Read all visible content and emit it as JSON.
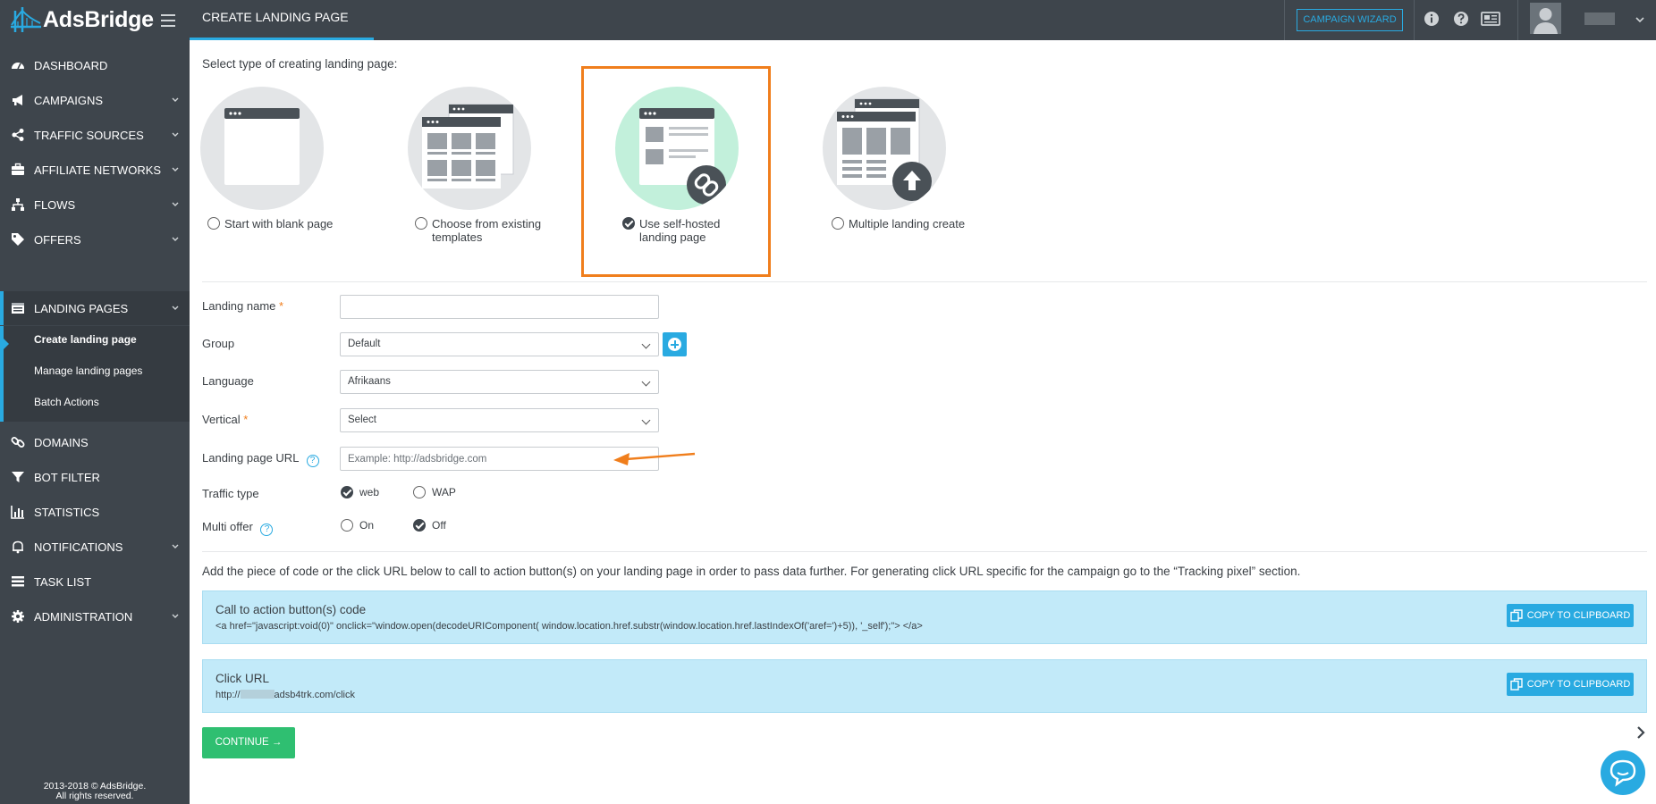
{
  "header": {
    "brand": "AdsBridge",
    "page_title": "CREATE LANDING PAGE",
    "campaign_wizard_label": "CAMPAIGN WIZARD"
  },
  "sidebar": {
    "items": [
      {
        "label": "DASHBOARD",
        "icon": "dashboard-icon"
      },
      {
        "label": "CAMPAIGNS",
        "icon": "megaphone-icon"
      },
      {
        "label": "TRAFFIC SOURCES",
        "icon": "share-icon"
      },
      {
        "label": "AFFILIATE NETWORKS",
        "icon": "briefcase-icon"
      },
      {
        "label": "FLOWS",
        "icon": "sitemap-icon"
      },
      {
        "label": "OFFERS",
        "icon": "tags-icon"
      },
      {
        "label": "LANDING PAGES",
        "icon": "landing-pages-icon"
      },
      {
        "label": "DOMAINS",
        "icon": "link-icon"
      },
      {
        "label": "BOT FILTER",
        "icon": "filter-icon"
      },
      {
        "label": "STATISTICS",
        "icon": "bar-chart-icon"
      },
      {
        "label": "NOTIFICATIONS",
        "icon": "bell-icon"
      },
      {
        "label": "TASK LIST",
        "icon": "list-icon"
      },
      {
        "label": "ADMINISTRATION",
        "icon": "gear-icon"
      }
    ],
    "sub_items": [
      "Create landing page",
      "Manage landing pages",
      "Batch Actions"
    ],
    "copyright_line1": "2013-2018 © AdsBridge.",
    "copyright_line2": "All rights reserved."
  },
  "main": {
    "select_type_title": "Select type of creating landing page:",
    "types": [
      {
        "label": "Start with blank page",
        "selected": false
      },
      {
        "label_line1": "Choose from existing",
        "label_line2": "templates",
        "selected": false
      },
      {
        "label_line1": "Use self-hosted",
        "label_line2": "landing page",
        "selected": true
      },
      {
        "label": "Multiple landing create",
        "selected": false
      }
    ],
    "form": {
      "landing_name_label": "Landing name",
      "landing_name_value": "",
      "group_label": "Group",
      "group_value": "Default",
      "language_label": "Language",
      "language_value": "Afrikaans",
      "vertical_label": "Vertical",
      "vertical_value": "Select",
      "url_label": "Landing page URL",
      "url_placeholder": "Example: http://adsbridge.com",
      "traffic_type_label": "Traffic type",
      "traffic_web": "web",
      "traffic_wap": "WAP",
      "traffic_selected": "web",
      "multi_offer_label": "Multi offer",
      "multi_on": "On",
      "multi_off": "Off",
      "multi_selected": "Off",
      "required_mark": "*",
      "help_mark": "?"
    },
    "info_text": "Add the piece of code or the click URL below to call to action button(s) on your landing page in order to pass data further. For generating click URL specific for the campaign go to the “Tracking pixel” section.",
    "cta_box": {
      "title": "Call to action button(s) code",
      "code": "<a href=\"javascript:void(0)\" onclick=\"window.open(decodeURIComponent( window.location.href.substr(window.location.href.lastIndexOf('aref=')+5)), '_self');\"> </a>",
      "copy_label": "COPY TO CLIPBOARD"
    },
    "click_box": {
      "title": "Click URL",
      "url_prefix": "http://",
      "url_suffix": "adsb4trk.com/click",
      "copy_label": "COPY TO CLIPBOARD"
    },
    "continue_label": "CONTINUE →"
  },
  "colors": {
    "sidebar_bg": "#3e454c",
    "accent": "#29aae1",
    "highlight": "#f07e1c",
    "success": "#2fbf71",
    "info_box": "#c2eaf9"
  }
}
